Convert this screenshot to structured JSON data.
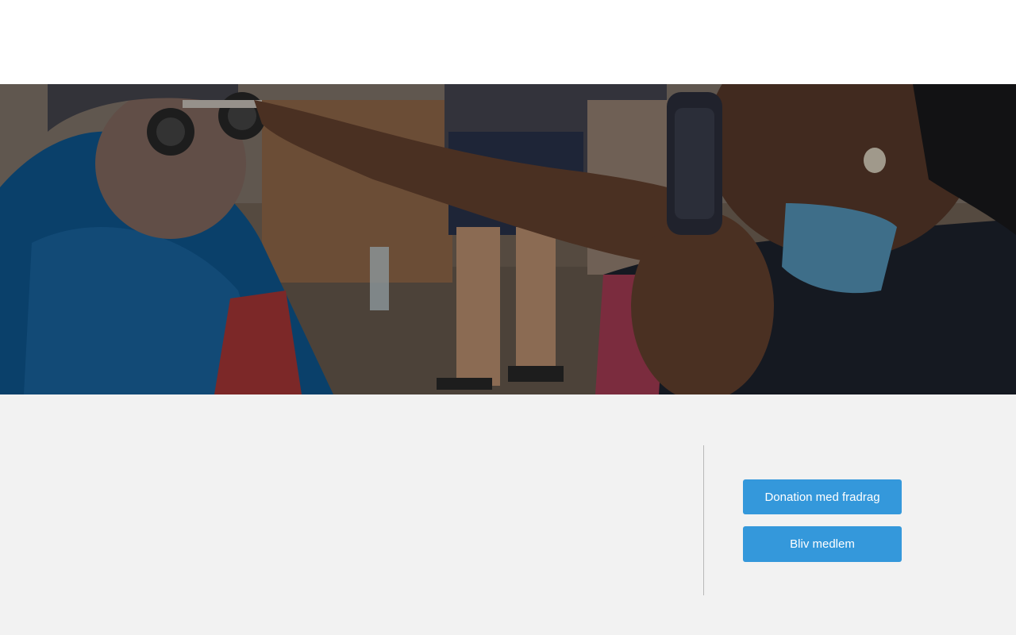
{
  "hero": {
    "image_alt": "Eye examination: an elderly woman wearing a trial frame while an examiner in a face mask holds a retinoscope"
  },
  "content": {
    "paragraphs": [
      "",
      ""
    ]
  },
  "actions": {
    "donate_label": "Donation med fradrag",
    "member_label": "Bliv medlem"
  },
  "colors": {
    "button": "#3498db",
    "button_text": "#ffffff",
    "background": "#f2f2f2",
    "header": "#ffffff",
    "divider": "#b9b9b9"
  }
}
